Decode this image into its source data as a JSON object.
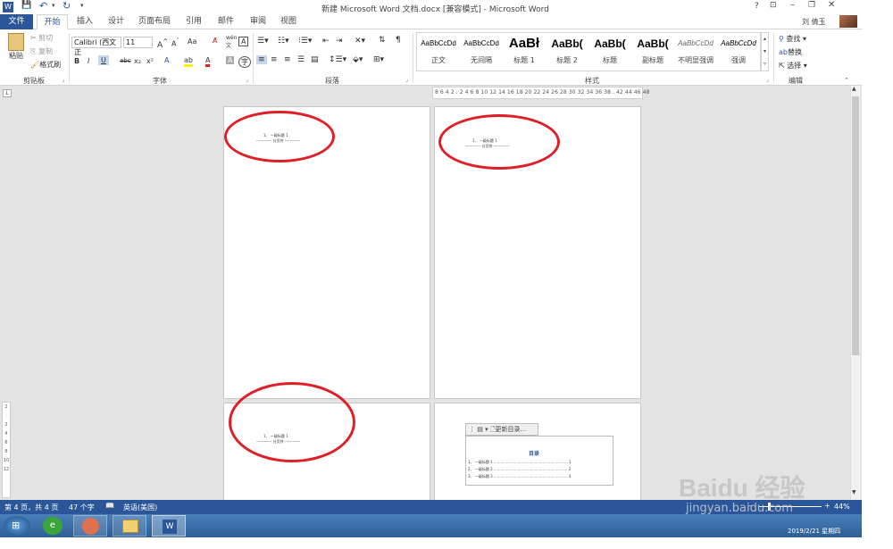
{
  "titlebar": {
    "title": "新建 Microsoft Word 文档.docx [兼容模式] - Microsoft Word",
    "help": "?",
    "user": "刘 倩玉"
  },
  "tabs": [
    "文件",
    "开始",
    "插入",
    "设计",
    "页面布局",
    "引用",
    "邮件",
    "审阅",
    "视图"
  ],
  "clipboard": {
    "paste": "粘贴",
    "cut": "剪切",
    "copy": "复制",
    "format_painter": "格式刷",
    "label": "剪贴板"
  },
  "font": {
    "name": "Calibri (西文正",
    "size": "11",
    "label": "字体",
    "aa": "Aa",
    "bold": "B",
    "italic": "I",
    "underline": "U",
    "strike": "abc",
    "sub": "x₂",
    "sup": "x²"
  },
  "paragraph": {
    "label": "段落"
  },
  "styles": {
    "label": "样式",
    "items": [
      {
        "sample": "AaBbCcDd",
        "name": "正文"
      },
      {
        "sample": "AaBbCcDd",
        "name": "无间隔"
      },
      {
        "sample": "AaBł",
        "name": "标题 1"
      },
      {
        "sample": "AaBb(",
        "name": "标题 2"
      },
      {
        "sample": "AaBb(",
        "name": "标题"
      },
      {
        "sample": "AaBb(",
        "name": "副标题"
      },
      {
        "sample": "AaBbCcDd",
        "name": "不明显强调"
      },
      {
        "sample": "AaBbCcDd",
        "name": "强调"
      }
    ]
  },
  "editing": {
    "find": "查找",
    "replace": "替换",
    "select": "选择",
    "label": "编辑"
  },
  "ruler": {
    "text": "8 6 4 2 . 2 4 6 8 10 12 14 16 18 20 22 24 26 28 30 32 34 36 38 . 42 44 46 48"
  },
  "pages": {
    "heading_line": "1、 一级标题 1",
    "break_line": "------------ 分页符 ------------",
    "toc_update": "更新目录...",
    "toc_title": "目录",
    "toc_rows": [
      "1、 一级标题 1 ................................................................. 1",
      "2、 一级标题 2 ................................................................. 2",
      "3、 一级标题 3 ................................................................. 3"
    ]
  },
  "status": {
    "page": "第 4 页，共 4 页",
    "words": "47 个字",
    "lang": "英语(美国)",
    "zoom": "44%"
  },
  "watermark": {
    "brand": "Baidu 经验",
    "url": "jingyan.baidu.com"
  },
  "taskbar": {
    "datetime": "2019/2/21 星期四"
  },
  "colors": {
    "accent": "#2b579a",
    "annotation": "#e01e26"
  }
}
